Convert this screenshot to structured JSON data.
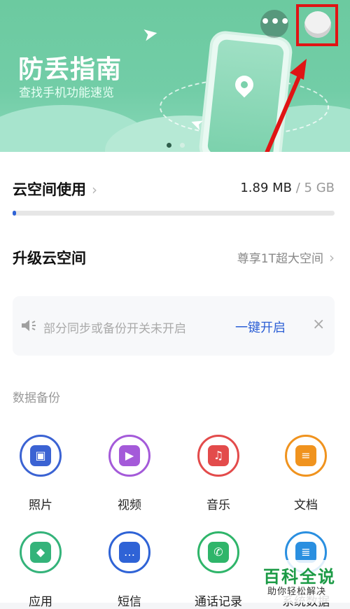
{
  "banner": {
    "title": "防丢指南",
    "subtitle": "查找手机功能速览",
    "more_icon": "ellipsis-icon",
    "colors": {
      "bg": "#6ccaa0",
      "highlight": "#e01414",
      "arrow": "#e01414"
    }
  },
  "storage": {
    "title": "云空间使用",
    "used": "1.89 MB",
    "separator": " / ",
    "total": "5 GB",
    "usage_fraction": 0.01,
    "bar_color": "#2f63d6"
  },
  "upgrade": {
    "title": "升级云空间",
    "promo": "尊享1T超大空间"
  },
  "notice": {
    "text": "部分同步或备份开关未开启",
    "action": "一键开启",
    "close": "×"
  },
  "backup": {
    "section_label": "数据备份",
    "items": [
      {
        "label": "照片",
        "icon": "photo-icon",
        "color": "#3b63d3"
      },
      {
        "label": "视频",
        "icon": "video-icon",
        "color": "#a45ad9"
      },
      {
        "label": "音乐",
        "icon": "music-icon",
        "color": "#e34b4b"
      },
      {
        "label": "文档",
        "icon": "document-icon",
        "color": "#f0931e"
      },
      {
        "label": "应用",
        "icon": "android-icon",
        "color": "#34b37a"
      },
      {
        "label": "短信",
        "icon": "message-icon",
        "color": "#2f63d6"
      },
      {
        "label": "通话记录",
        "icon": "phone-icon",
        "color": "#2fb56a"
      },
      {
        "label": "系统数据",
        "icon": "database-icon",
        "color": "#2a8fe0"
      }
    ]
  },
  "watermark": {
    "logo": "百科全说",
    "sub": "助你轻松解决"
  }
}
